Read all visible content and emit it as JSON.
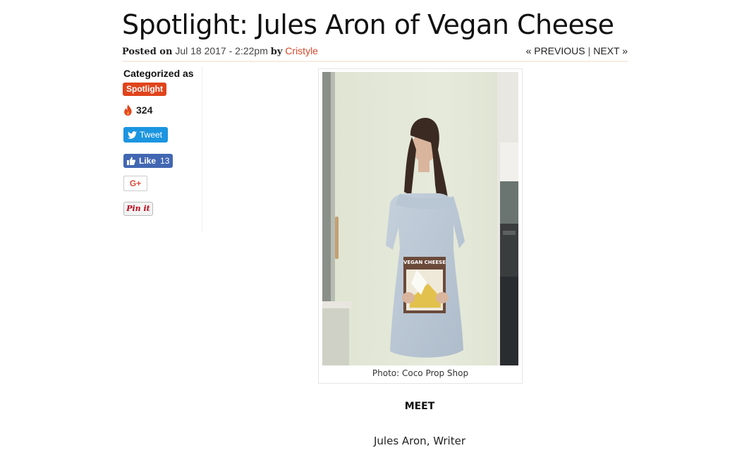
{
  "post": {
    "title": "Spotlight: Jules Aron of Vegan Cheese",
    "posted_label": "Posted on",
    "date": "Jul 18 2017 - 2:22pm",
    "by_label": "by",
    "author": "Cristyle"
  },
  "nav": {
    "previous": "« PREVIOUS",
    "separator": "|",
    "next": "NEXT »"
  },
  "sidebar": {
    "categorized_label": "Categorized as",
    "category": "Spotlight",
    "hot_count": "324",
    "tweet_label": "Tweet",
    "like_label": "Like",
    "like_count": "13",
    "gplus_label": "G+",
    "pinit_label": "Pin it",
    "icons": [
      "flame-icon",
      "twitter-bird-icon",
      "thumbs-up-icon"
    ]
  },
  "figure": {
    "caption": "Photo: Coco Prop Shop",
    "book_title_top": "VEGAN CHEESE"
  },
  "body": {
    "meet_heading": "MEET",
    "meet_name": "Jules Aron, Writer"
  },
  "colors": {
    "accent": "#e0441c",
    "author_link": "#d9482b",
    "twitter": "#1b95e0",
    "facebook": "#4267b2"
  }
}
